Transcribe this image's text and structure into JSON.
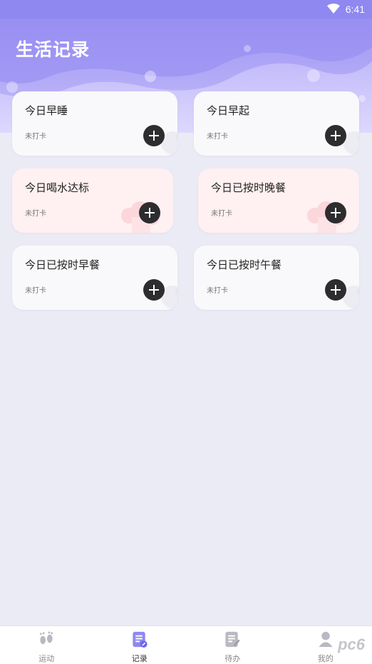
{
  "status_bar": {
    "time": "6:41",
    "wifi_icon": "wifi-icon"
  },
  "header": {
    "title": "生活记录"
  },
  "cards": [
    {
      "title": "今日早睡",
      "status": "未打卡",
      "theme": "white"
    },
    {
      "title": "今日早起",
      "status": "未打卡",
      "theme": "white"
    },
    {
      "title": "今日喝水达标",
      "status": "未打卡",
      "theme": "pink"
    },
    {
      "title": "今日已按时晚餐",
      "status": "未打卡",
      "theme": "pink"
    },
    {
      "title": "今日已按时早餐",
      "status": "未打卡",
      "theme": "white"
    },
    {
      "title": "今日已按时午餐",
      "status": "未打卡",
      "theme": "white"
    }
  ],
  "bottom_nav": [
    {
      "label": "运动",
      "icon": "footprints-icon",
      "active": false
    },
    {
      "label": "记录",
      "icon": "record-icon",
      "active": true
    },
    {
      "label": "待办",
      "icon": "todo-icon",
      "active": false
    },
    {
      "label": "我的",
      "icon": "profile-icon",
      "active": false
    }
  ],
  "watermark": "pc6",
  "colors": {
    "accent": "#8f88f0",
    "header_light": "#c9c2fb",
    "background": "#ebebf5",
    "button": "#2d2d2f",
    "pink_card": "#fff0f1"
  }
}
